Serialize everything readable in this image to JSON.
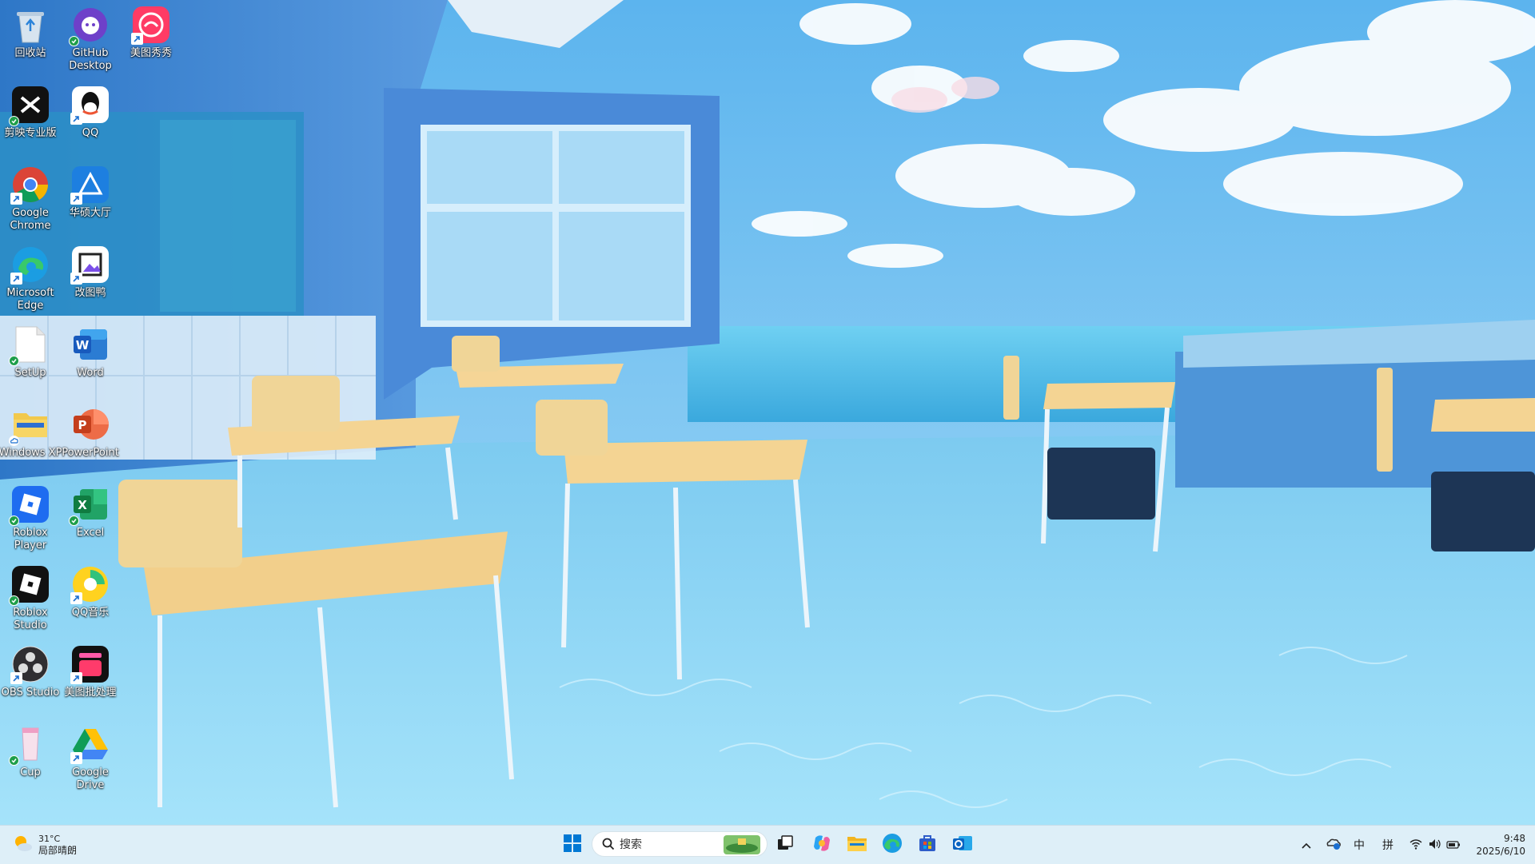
{
  "desktop": {
    "icons": [
      {
        "label": "回收站",
        "icon": "recycle-bin-icon"
      },
      {
        "label": "GitHub Desktop",
        "icon": "github-icon"
      },
      {
        "label": "美图秀秀",
        "icon": "meitu-icon"
      },
      {
        "label": "剪映专业版",
        "icon": "capcut-icon"
      },
      {
        "label": "QQ",
        "icon": "qq-icon"
      },
      {
        "label": "Google Chrome",
        "icon": "chrome-icon"
      },
      {
        "label": "华硕大厅",
        "icon": "asus-hub-icon"
      },
      {
        "label": "Microsoft Edge",
        "icon": "edge-icon"
      },
      {
        "label": "改图鸭",
        "icon": "gaituya-icon"
      },
      {
        "label": "SetUp",
        "icon": "setup-file-icon"
      },
      {
        "label": "Word",
        "icon": "word-icon"
      },
      {
        "label": "Windows XP",
        "icon": "folder-icon"
      },
      {
        "label": "PowerPoint",
        "icon": "powerpoint-icon"
      },
      {
        "label": "Roblox Player",
        "icon": "roblox-player-icon"
      },
      {
        "label": "Excel",
        "icon": "excel-icon"
      },
      {
        "label": "Roblox Studio",
        "icon": "roblox-studio-icon"
      },
      {
        "label": "QQ音乐",
        "icon": "qq-music-icon"
      },
      {
        "label": "OBS Studio",
        "icon": "obs-icon"
      },
      {
        "label": "美图批处理",
        "icon": "meitu-batch-icon"
      },
      {
        "label": "Cup",
        "icon": "cup-file-icon"
      },
      {
        "label": "Google Drive",
        "icon": "google-drive-icon"
      }
    ]
  },
  "taskbar": {
    "weather": {
      "temp": "31°C",
      "desc": "局部晴朗"
    },
    "search": {
      "placeholder": "搜索"
    },
    "apps": [
      "start-icon",
      "search-icon",
      "widgets-icon",
      "task-view-icon",
      "copilot-icon",
      "file-explorer-icon",
      "edge-icon",
      "store-icon",
      "outlook-icon"
    ],
    "tray": {
      "ime_lang": "中",
      "ime_mode": "拼",
      "time": "9:48",
      "date": "2025/6/10"
    }
  },
  "colors": {
    "accent": "#0078d4",
    "taskbar": "#dceef7"
  }
}
